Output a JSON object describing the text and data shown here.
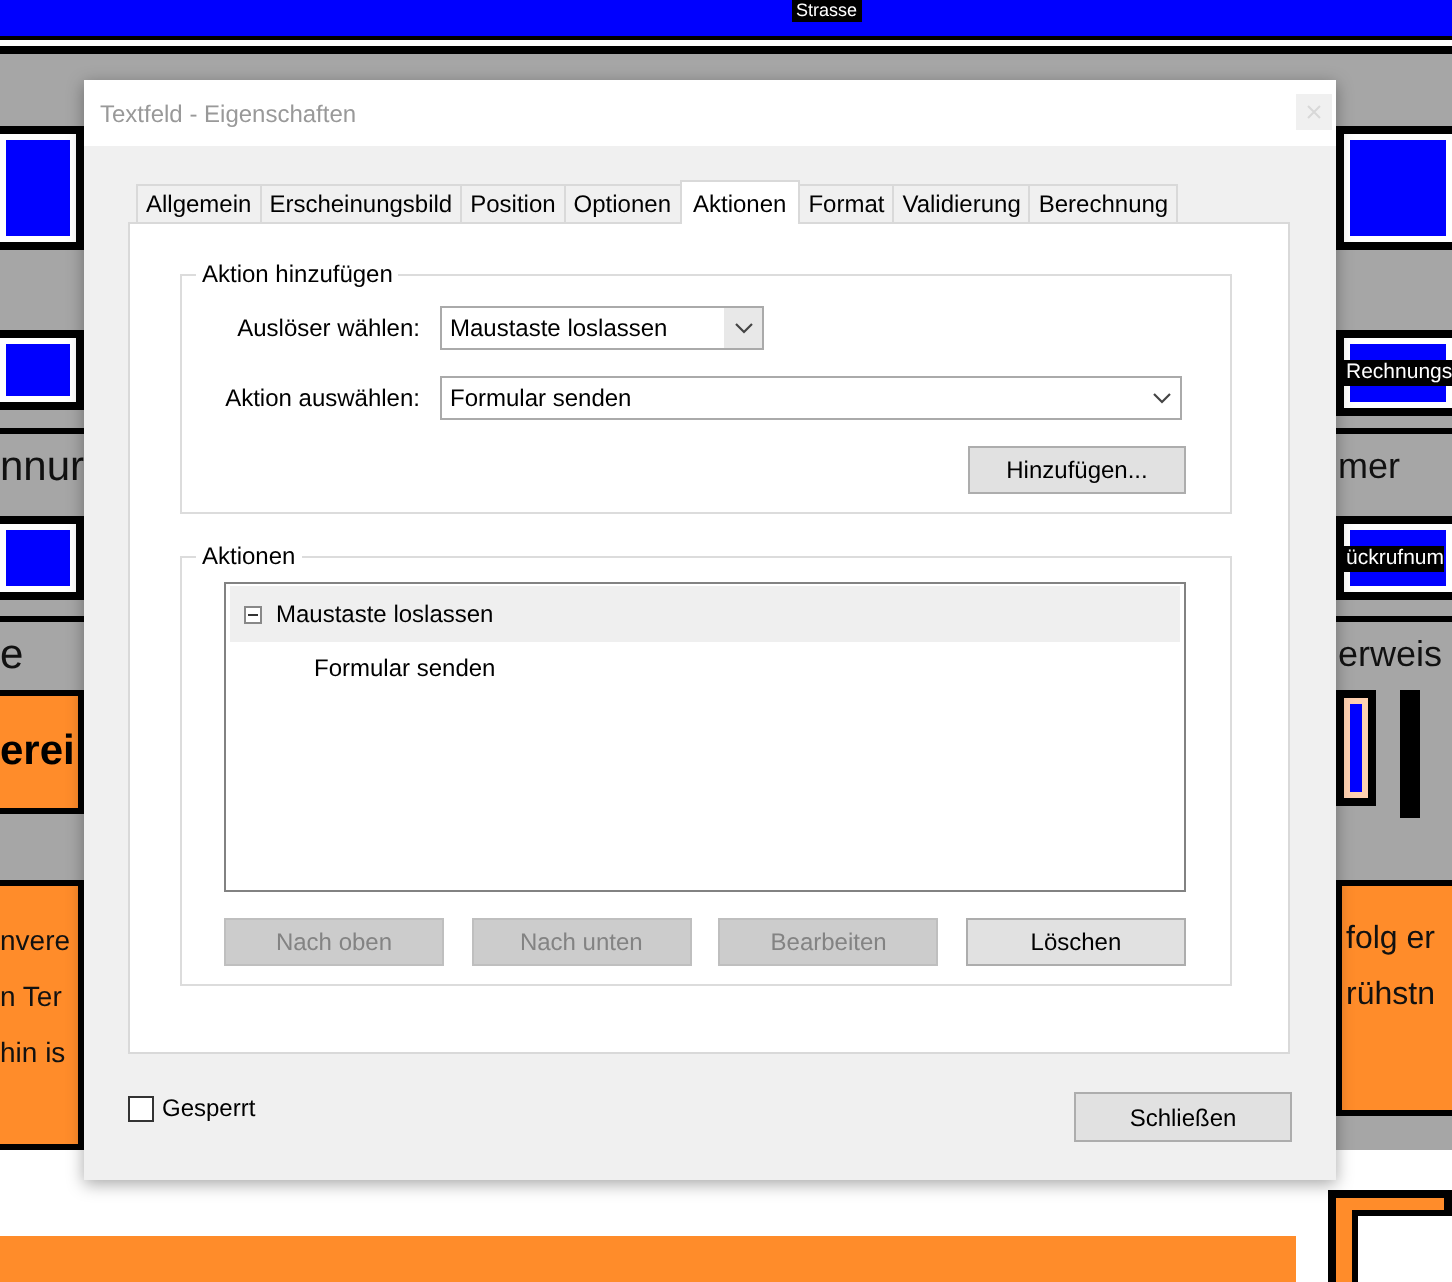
{
  "document": {
    "top_label": "Strasse",
    "left_column": [
      {
        "kind": "field"
      },
      {
        "kind": "field"
      },
      {
        "kind": "caption",
        "text": "nnur"
      },
      {
        "kind": "field"
      },
      {
        "kind": "caption",
        "text": "e"
      },
      {
        "kind": "banner",
        "text": "erei"
      },
      {
        "kind": "note",
        "lines": [
          "nvere",
          "n Ter",
          "hin is"
        ]
      }
    ],
    "right_column": [
      {
        "kind": "field"
      },
      {
        "kind": "labeled_field",
        "text": "Rechnungs"
      },
      {
        "kind": "caption",
        "text": "mer"
      },
      {
        "kind": "labeled_field",
        "text": "ückrufnum"
      },
      {
        "kind": "caption",
        "text": "erweis"
      },
      {
        "kind": "checkboxes"
      },
      {
        "kind": "note",
        "lines": [
          "folg er",
          "rühstn"
        ]
      }
    ]
  },
  "dialog": {
    "title": "Textfeld - Eigenschaften",
    "tabs": [
      {
        "label": "Allgemein",
        "selected": false
      },
      {
        "label": "Erscheinungsbild",
        "selected": false
      },
      {
        "label": "Position",
        "selected": false
      },
      {
        "label": "Optionen",
        "selected": false
      },
      {
        "label": "Aktionen",
        "selected": true
      },
      {
        "label": "Format",
        "selected": false
      },
      {
        "label": "Validierung",
        "selected": false
      },
      {
        "label": "Berechnung",
        "selected": false
      }
    ],
    "add_action": {
      "title": "Aktion hinzufügen",
      "trigger": {
        "label": "Auslöser wählen:",
        "value": "Maustaste loslassen"
      },
      "action": {
        "label": "Aktion auswählen:",
        "value": "Formular senden"
      },
      "add_button": "Hinzufügen..."
    },
    "actions": {
      "title": "Aktionen",
      "tree": [
        {
          "label": "Maustaste loslassen",
          "expanded": true,
          "selected": true,
          "children": [
            {
              "label": "Formular senden",
              "selected": false
            }
          ]
        }
      ],
      "buttons": [
        {
          "label": "Nach oben",
          "disabled": true
        },
        {
          "label": "Nach unten",
          "disabled": true
        },
        {
          "label": "Bearbeiten",
          "disabled": true
        },
        {
          "label": "Löschen",
          "disabled": false
        }
      ]
    },
    "locked": {
      "label": "Gesperrt",
      "checked": false
    },
    "close_button": "Schließen"
  }
}
